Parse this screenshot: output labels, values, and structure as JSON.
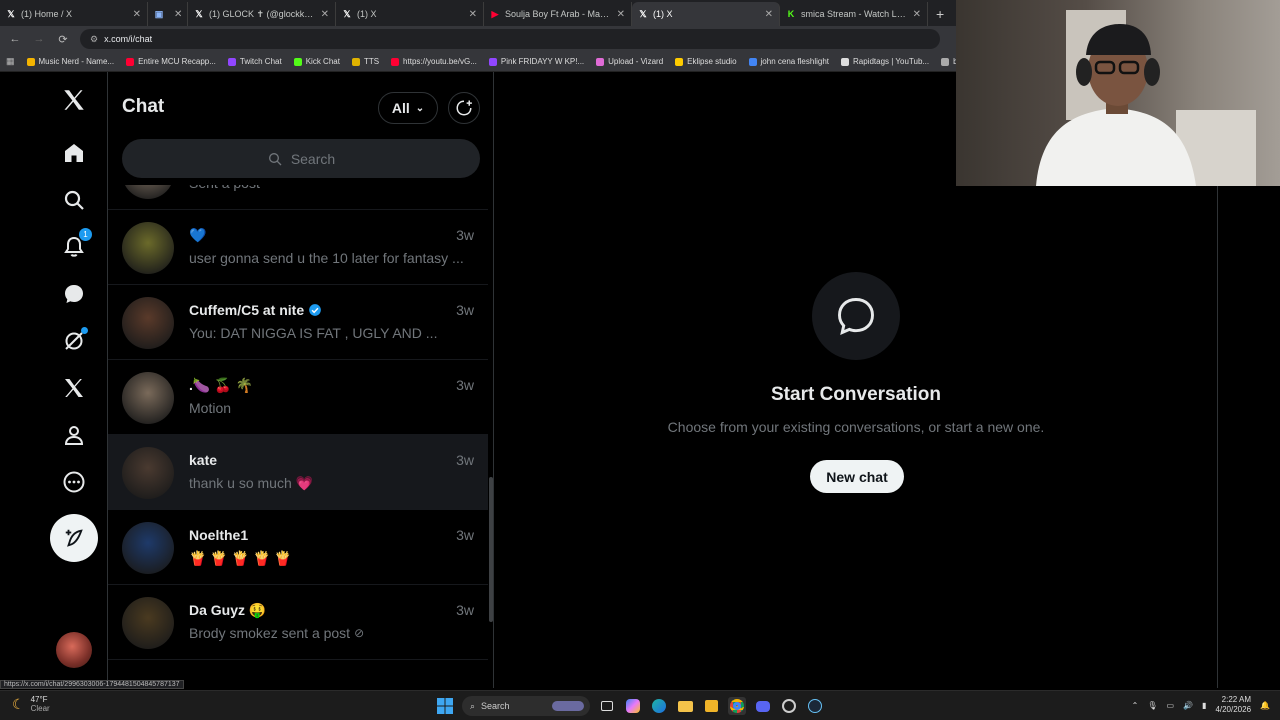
{
  "browser": {
    "tabs": [
      {
        "label": "(1) Home / X",
        "icon": "x-icon",
        "color": "#ffffff"
      },
      {
        "label": "",
        "icon": "media-icon",
        "color": "#8ab4f8"
      },
      {
        "label": "(1) GLOCK ✝ (@glockk1tty) / X",
        "icon": "x-icon",
        "color": "#ffffff"
      },
      {
        "label": "(1) X",
        "icon": "x-icon",
        "color": "#ffffff"
      },
      {
        "label": "Soulja Boy Ft Arab - Mansion I",
        "icon": "youtube-icon",
        "color": "#ff0033"
      },
      {
        "label": "(1) X",
        "icon": "x-icon",
        "color": "#ffffff"
      },
      {
        "label": "smica Stream - Watch Live on K",
        "icon": "kick-icon",
        "color": "#53fc18"
      }
    ],
    "new_tab": "+",
    "url": "x.com/i/chat",
    "bookmarks": [
      {
        "label": "Music Nerd - Name...",
        "color": "#f4b400"
      },
      {
        "label": "Entire MCU Recapp...",
        "color": "#ff0033"
      },
      {
        "label": "Twitch Chat",
        "color": "#9146ff"
      },
      {
        "label": "Kick Chat",
        "color": "#53fc18"
      },
      {
        "label": "TTS",
        "color": "#e0b300"
      },
      {
        "label": "https://youtu.be/vG...",
        "color": "#ff0033"
      },
      {
        "label": "Pink FRIDAYY W KP!...",
        "color": "#9146ff"
      },
      {
        "label": "Upload - Vizard",
        "color": "#e06bd6"
      },
      {
        "label": "Eklipse studio",
        "color": "#ffcc00"
      },
      {
        "label": "john cena fleshlight",
        "color": "#4285f4"
      },
      {
        "label": "Rapidtags | YouTub...",
        "color": "#dddddd"
      },
      {
        "label": "bih links",
        "color": "#aaaaaa"
      }
    ]
  },
  "nav": {
    "notifications_badge": "1"
  },
  "chat": {
    "title": "Chat",
    "filter_label": "All",
    "search_placeholder": "Search",
    "conversations": [
      {
        "name": "",
        "message": "Sent a post",
        "time": "",
        "avatar_color": "#8a7a6a"
      },
      {
        "name": "💙",
        "message": "user gonna send u the 10 later for fantasy ...",
        "time": "3w",
        "avatar_color": "#6b6a2a"
      },
      {
        "name": "Cuffem/C5 at nite",
        "verified": true,
        "message": "You: DAT NIGGA IS FAT , UGLY AND ...",
        "time": "3w",
        "avatar_color": "#5a3a2a"
      },
      {
        "name": ".🍆 🍒 🌴",
        "message": "Motion",
        "time": "3w",
        "avatar_color": "#7a6a5a"
      },
      {
        "name": "kate",
        "message": "thank u so much 💗",
        "time": "3w",
        "avatar_color": "#4a3a30"
      },
      {
        "name": "Noelthe1",
        "message": "🍟 🍟 🍟 🍟 🍟",
        "time": "3w",
        "avatar_color": "#1e3a6a"
      },
      {
        "name": "Da Guyz 🤑",
        "message": "Brody smokez sent a post",
        "time": "3w",
        "avatar_color": "#4a3a20"
      }
    ]
  },
  "empty_state": {
    "title": "Start Conversation",
    "subtitle": "Choose from your existing conversations, or start a new one.",
    "button": "New chat"
  },
  "status_url": "https://x.com/i/chat/2996303006-1794481504845787137",
  "taskbar": {
    "temperature": "47°F",
    "condition": "Clear",
    "search_label": "Search",
    "time": "2:22 AM",
    "date": "4/20/2026"
  },
  "colors": {
    "accent": "#1d9bf0",
    "background": "#000000",
    "border": "#2f3336",
    "muted_text": "#71767b"
  }
}
